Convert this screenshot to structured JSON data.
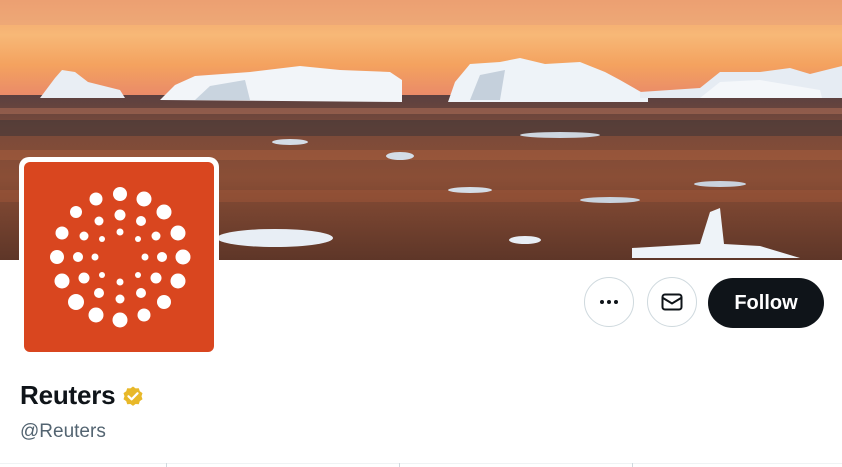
{
  "profile": {
    "display_name": "Reuters",
    "handle": "@Reuters",
    "verified": true,
    "badge_color": "#e8b829",
    "avatar_color": "#d9461f"
  },
  "actions": {
    "more_icon": "more-horizontal-icon",
    "message_icon": "envelope-icon",
    "follow_label": "Follow"
  },
  "banner": {
    "scene": "sunset-icebergs"
  }
}
